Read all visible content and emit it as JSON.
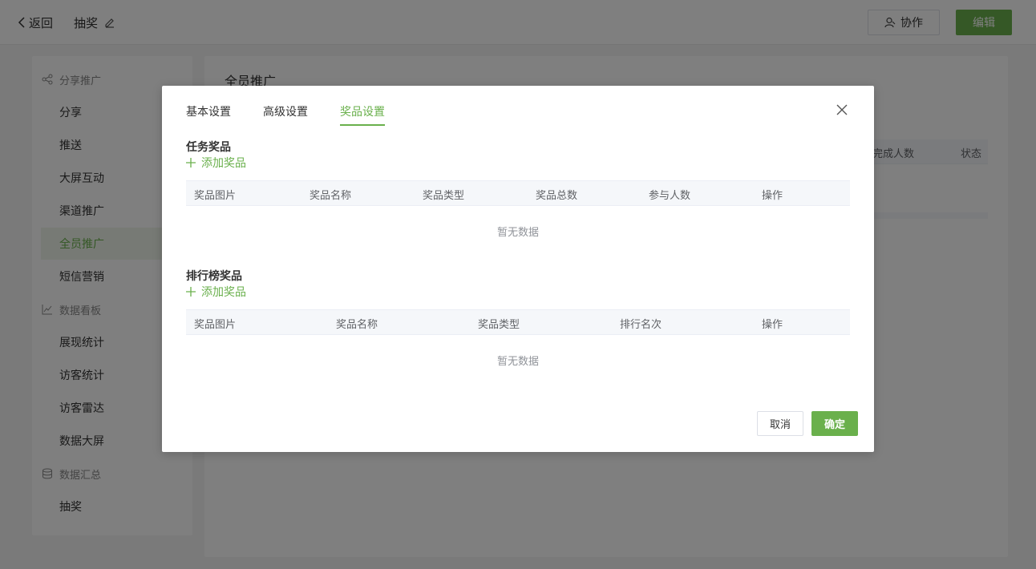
{
  "header": {
    "back_label": "返回",
    "title": "抽奖",
    "collab_label": "协作",
    "edit_label": "编辑"
  },
  "sidebar": {
    "groups": [
      {
        "label": "分享推广",
        "icon": "share-icon"
      },
      {
        "label": "数据看板",
        "icon": "chart-line-icon"
      },
      {
        "label": "数据汇总",
        "icon": "database-icon"
      }
    ],
    "items": [
      {
        "label": "分享"
      },
      {
        "label": "推送"
      },
      {
        "label": "大屏互动"
      },
      {
        "label": "渠道推广"
      },
      {
        "label": "全员推广",
        "active": true
      },
      {
        "label": "短信营销"
      },
      {
        "label": "展现统计"
      },
      {
        "label": "访客统计"
      },
      {
        "label": "访客雷达"
      },
      {
        "label": "数据大屏"
      },
      {
        "label": "抽奖"
      }
    ]
  },
  "main": {
    "title": "全员推广",
    "table_headers": [
      "完成人数",
      "状态"
    ]
  },
  "dialog": {
    "tabs": [
      {
        "label": "基本设置"
      },
      {
        "label": "高级设置"
      },
      {
        "label": "奖品设置",
        "active": true
      }
    ],
    "task_section": {
      "title": "任务奖品",
      "add_label": "添加奖品",
      "columns": [
        "奖品图片",
        "奖品名称",
        "奖品类型",
        "奖品总数",
        "参与人数",
        "操作"
      ],
      "empty_text": "暂无数据"
    },
    "rank_section": {
      "title": "排行榜奖品",
      "add_label": "添加奖品",
      "columns": [
        "奖品图片",
        "奖品名称",
        "奖品类型",
        "排行名次",
        "操作"
      ],
      "empty_text": "暂无数据"
    },
    "cancel_label": "取消",
    "ok_label": "确定"
  },
  "colors": {
    "accent": "#6ab04c",
    "active_bg": "#eef5ea",
    "overlay": "rgba(0,0,0,0.5)"
  }
}
